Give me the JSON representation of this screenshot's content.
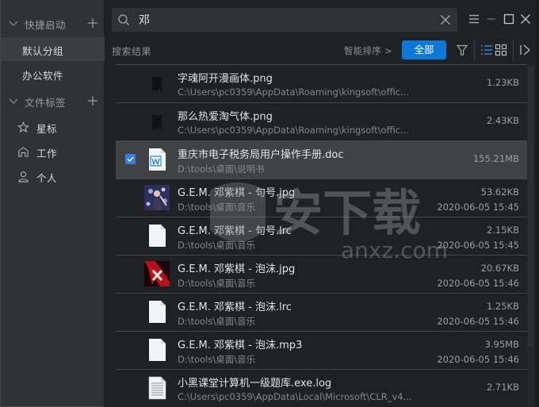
{
  "sidebar": {
    "sections": [
      {
        "title": "快捷启动",
        "items": [
          {
            "label": "默认分组",
            "active": true
          },
          {
            "label": "办公软件",
            "active": false
          }
        ]
      },
      {
        "title": "文件标签",
        "items": [
          {
            "label": "星标",
            "icon": "star-icon"
          },
          {
            "label": "工作",
            "icon": "home-icon"
          },
          {
            "label": "个人",
            "icon": "person-icon"
          }
        ]
      }
    ]
  },
  "search": {
    "value": "邓",
    "placeholder": ""
  },
  "toolbar": {
    "results_label": "搜索结果",
    "sort_label": "智能排序 >",
    "all_label": "全部"
  },
  "colors": {
    "accent": "#0e78d8",
    "checkbox": "#3a7ee4",
    "selected_row": "#404246",
    "sidebar_bg": "#303236",
    "main_bg": "#1f2124"
  },
  "results": [
    {
      "name": "字魂阿开漫画体.png",
      "path": "C:\\Users\\pc0359\\AppData\\Roaming\\kingsoft\\offic...",
      "size": "1.23KB",
      "date": "",
      "thumb": "font-preview-thumbnail",
      "selected": false
    },
    {
      "name": "那么热爱淘气体.png",
      "path": "C:\\Users\\pc0359\\AppData\\Roaming\\kingsoft\\offic...",
      "size": "2.43KB",
      "date": "",
      "thumb": "font-preview-thumbnail",
      "selected": false
    },
    {
      "name": "重庆市电子税务局用户操作手册.doc",
      "path": "D:\\tools\\桌面\\说明书",
      "size": "155.21MB",
      "date": "",
      "thumb": "word-doc-icon",
      "selected": true
    },
    {
      "name": "G.E.M. 邓紫棋 - 句号.jpg",
      "path": "D:\\tools\\桌面\\音乐",
      "size": "53.62KB",
      "date": "2020-06-05 15:45",
      "thumb": "album-cover-thumbnail",
      "selected": false
    },
    {
      "name": "G.E.M. 邓紫棋 - 句号.lrc",
      "path": "D:\\tools\\桌面\\音乐",
      "size": "2.15KB",
      "date": "2020-06-05 15:45",
      "thumb": "blank-file-icon",
      "selected": false
    },
    {
      "name": "G.E.M. 邓紫棋 - 泡沫.jpg",
      "path": "D:\\tools\\桌面\\音乐",
      "size": "20.67KB",
      "date": "2020-06-05 15:46",
      "thumb": "album-cover-red-thumbnail",
      "selected": false
    },
    {
      "name": "G.E.M. 邓紫棋 - 泡沫.lrc",
      "path": "D:\\tools\\桌面\\音乐",
      "size": "1.25KB",
      "date": "2020-06-05 15:46",
      "thumb": "blank-file-icon",
      "selected": false
    },
    {
      "name": "G.E.M. 邓紫棋 - 泡沫.mp3",
      "path": "D:\\tools\\桌面\\音乐",
      "size": "3.95MB",
      "date": "2020-06-05 15:46",
      "thumb": "blank-file-icon",
      "selected": false
    },
    {
      "name": "小黑课堂计算机一级题库.exe.log",
      "path": "C:\\Users\\pc0359\\AppData\\Local\\Microsoft\\CLR_v4...",
      "size": "2.71KB",
      "date": "",
      "thumb": "text-file-icon",
      "selected": false
    }
  ],
  "watermark": {
    "text": "安下载",
    "subtext": "anxz.com"
  }
}
